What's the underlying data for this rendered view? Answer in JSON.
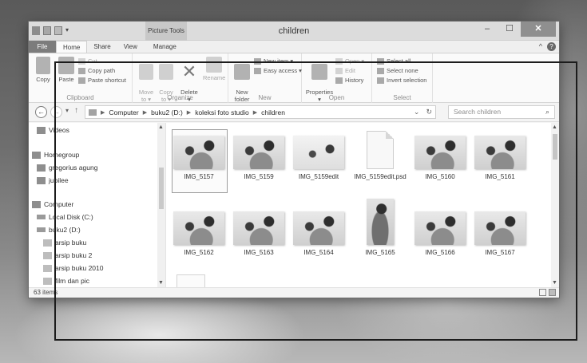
{
  "window": {
    "title": "children",
    "context_tab": "Picture Tools",
    "minimize": "–",
    "maximize": "☐",
    "close": "✕"
  },
  "ribbon_tabs": [
    "File",
    "Home",
    "Share",
    "View",
    "Manage"
  ],
  "ribbon": {
    "clipboard": {
      "label": "Clipboard",
      "copy": "Copy",
      "paste": "Paste",
      "cut": "Cut",
      "copy_path": "Copy path",
      "paste_shortcut": "Paste shortcut"
    },
    "organize": {
      "label": "Organize",
      "move_to": "Move\nto ▾",
      "copy_to": "Copy\nto ▾",
      "delete": "Delete\n▾",
      "rename": "Rename"
    },
    "new": {
      "label": "New",
      "new_folder": "New\nfolder",
      "new_item": "New item ▾",
      "easy_access": "Easy access ▾"
    },
    "open": {
      "label": "Open",
      "properties": "Properties\n▾",
      "open": "Open ▾",
      "edit": "Edit",
      "history": "History"
    },
    "select": {
      "label": "Select",
      "select_all": "Select all",
      "select_none": "Select none",
      "invert_selection": "Invert selection"
    }
  },
  "address": {
    "breadcrumbs": [
      "Computer",
      "buku2 (D:)",
      "koleksi foto studio",
      "children"
    ],
    "search_placeholder": "Search children"
  },
  "nav_pane": [
    {
      "label": "Videos",
      "icon": "video-icon"
    },
    {
      "label": "Homegroup",
      "icon": "homegroup-icon"
    },
    {
      "label": "gregorius agung",
      "icon": "user-icon"
    },
    {
      "label": "jubilee",
      "icon": "user-icon"
    },
    {
      "label": "Computer",
      "icon": "computer-icon"
    },
    {
      "label": "Local Disk (C:)",
      "icon": "drive-icon"
    },
    {
      "label": "buku2 (D:)",
      "icon": "drive-icon"
    },
    {
      "label": "arsip buku",
      "icon": "folder-icon"
    },
    {
      "label": "arsip buku 2",
      "icon": "folder-icon"
    },
    {
      "label": "arsip buku 2010",
      "icon": "folder-icon"
    },
    {
      "label": "film dan pic",
      "icon": "folder-icon"
    }
  ],
  "files": [
    {
      "name": "IMG_5157",
      "kind": "photo"
    },
    {
      "name": "IMG_5159",
      "kind": "photo"
    },
    {
      "name": "IMG_5159edit",
      "kind": "edit"
    },
    {
      "name": "IMG_5159edit.psd",
      "kind": "doc"
    },
    {
      "name": "IMG_5160",
      "kind": "photo"
    },
    {
      "name": "IMG_5161",
      "kind": "photo"
    },
    {
      "name": "IMG_5162",
      "kind": "photo"
    },
    {
      "name": "IMG_5163",
      "kind": "photo"
    },
    {
      "name": "IMG_5164",
      "kind": "photo"
    },
    {
      "name": "IMG_5165",
      "kind": "tall"
    },
    {
      "name": "IMG_5166",
      "kind": "photo"
    },
    {
      "name": "IMG_5167",
      "kind": "photo"
    }
  ],
  "status": {
    "item_count": "63 items"
  }
}
